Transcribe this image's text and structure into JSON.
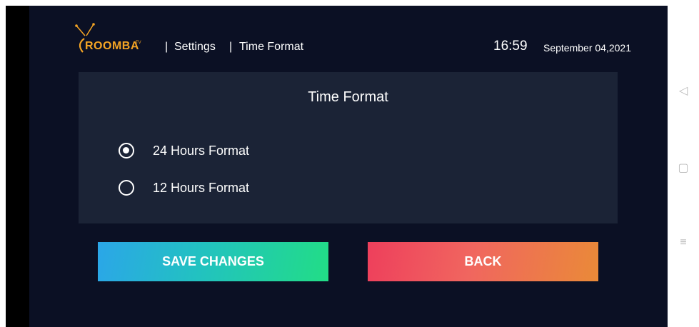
{
  "header": {
    "logo_text": "ROOMBA",
    "logo_tm": "TV",
    "separator": "|",
    "breadcrumb": [
      "Settings",
      "Time Format"
    ],
    "time": "16:59",
    "date": "September 04,2021"
  },
  "panel": {
    "title": "Time Format",
    "options": [
      {
        "label": "24 Hours Format",
        "selected": true
      },
      {
        "label": "12 Hours Format",
        "selected": false
      }
    ]
  },
  "buttons": {
    "save_label": "SAVE CHANGES",
    "back_label": "BACK"
  },
  "nav_icons": {
    "back": "◁",
    "home": "▢",
    "menu": "≡"
  },
  "colors": {
    "background": "#0b1024",
    "panel": "#1b2336",
    "logo": "#f5a524",
    "save_gradient": [
      "#2ba6e8",
      "#22dd86"
    ],
    "back_gradient": [
      "#ee3f5c",
      "#ea8a38"
    ]
  }
}
